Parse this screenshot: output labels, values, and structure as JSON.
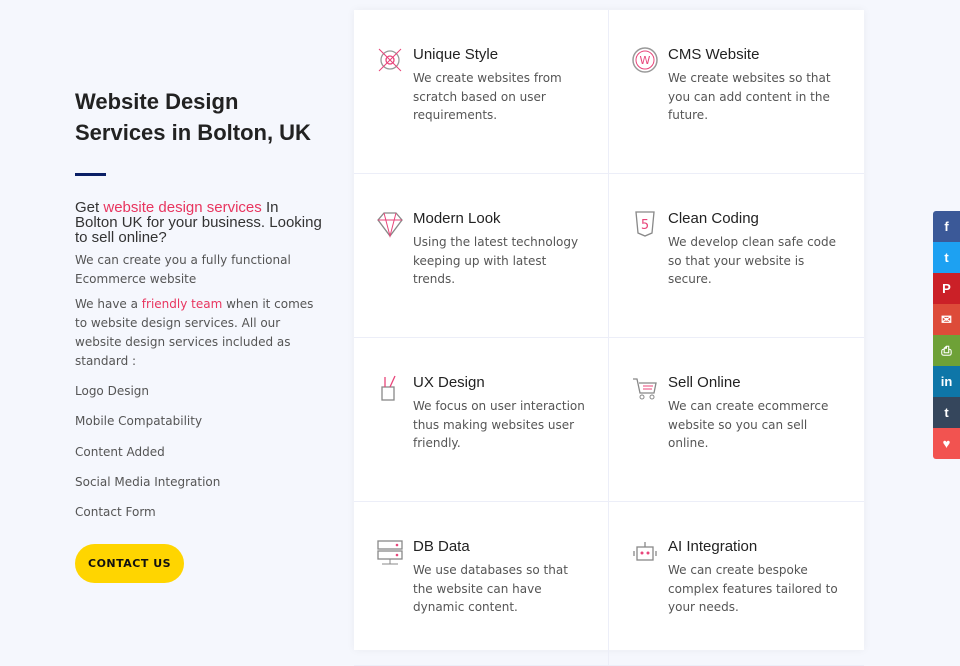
{
  "intro": {
    "title": "Website Design Services in Bolton, UK",
    "lead_pre": "Get ",
    "lead_link": "website design services",
    "lead_post": " In Bolton UK for your business. Looking to sell online?",
    "p1": "We can create you a fully functional Ecommerce website",
    "p2_pre": "We have a ",
    "p2_link": "friendly team",
    "p2_post": " when it comes to website design services.  All our website design services included as standard :",
    "list": [
      "Logo Design",
      "Mobile Compatability",
      "Content Added",
      "Social Media Integration",
      "Contact Form"
    ],
    "cta": "CONTACT US"
  },
  "services": [
    {
      "title": "Unique Style",
      "desc": "We create websites from scratch based on user requirements.",
      "icon": "target-icon"
    },
    {
      "title": "CMS Website",
      "desc": "We create websites so that you can add content in the future.",
      "icon": "wordpress-icon"
    },
    {
      "title": "Modern Look",
      "desc": "Using the latest technology keeping up with latest trends.",
      "icon": "diamond-icon"
    },
    {
      "title": "Clean Coding",
      "desc": "We develop clean safe code so that your website is secure.",
      "icon": "html5-icon"
    },
    {
      "title": "UX Design",
      "desc": "We focus on user interaction thus making websites user friendly.",
      "icon": "pencil-cup-icon"
    },
    {
      "title": "Sell Online",
      "desc": "We can create ecommerce website so you can sell online.",
      "icon": "cart-icon"
    },
    {
      "title": "DB Data",
      "desc": "We use databases so that the website can have dynamic content.",
      "icon": "server-icon"
    },
    {
      "title": "AI Integration",
      "desc": "We can create bespoke complex features tailored to your needs.",
      "icon": "robot-icon"
    }
  ],
  "social": [
    {
      "name": "facebook",
      "glyph": "f",
      "color": "#3b5998"
    },
    {
      "name": "twitter",
      "glyph": "t",
      "color": "#1da1f2"
    },
    {
      "name": "pinterest",
      "glyph": "P",
      "color": "#cb2027"
    },
    {
      "name": "email",
      "glyph": "✉",
      "color": "#dd4b39"
    },
    {
      "name": "print",
      "glyph": "⎙",
      "color": "#6ea137"
    },
    {
      "name": "linkedin",
      "glyph": "in",
      "color": "#0e76a8"
    },
    {
      "name": "tumblr",
      "glyph": "t",
      "color": "#35465c"
    },
    {
      "name": "love",
      "glyph": "♥",
      "color": "#f25350"
    }
  ]
}
